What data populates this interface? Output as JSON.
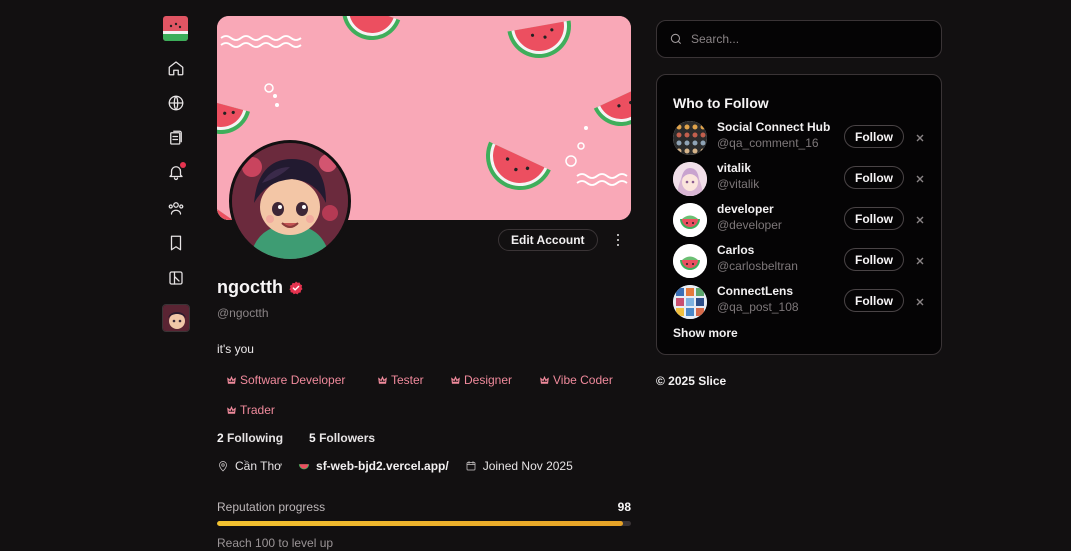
{
  "nav": {
    "icons": [
      "home-icon",
      "globe-icon",
      "clipboard-icon",
      "bell-icon",
      "users-icon",
      "bookmark-icon",
      "premium-icon"
    ],
    "notification_dot_color": "#e5334f"
  },
  "profile": {
    "display_name": "ngoctth",
    "handle": "@ngoctth",
    "bio": "it's you",
    "edit_label": "Edit Account",
    "tags": [
      "Software Developer",
      "Tester",
      "Designer",
      "Vibe Coder",
      "Trader"
    ],
    "following_count": "2",
    "following_label": "Following",
    "followers_count": "5",
    "followers_label": "Followers",
    "location": "Cần Thơ",
    "website": "sf-web-bjd2.vercel.app/",
    "joined": "Joined Nov 2025",
    "reputation_label": "Reputation progress",
    "reputation_value": "98",
    "reputation_progress": 0.98,
    "reputation_hint": "Reach 100 to level up"
  },
  "search": {
    "placeholder": "Search..."
  },
  "who_to_follow": {
    "title": "Who to Follow",
    "follow_label": "Follow",
    "show_more": "Show more",
    "users": [
      {
        "name": "Social Connect Hub",
        "handle": "@qa_comment_16",
        "avatar": "grid-avatar"
      },
      {
        "name": "vitalik",
        "handle": "@vitalik",
        "avatar": "anime-avatar"
      },
      {
        "name": "developer",
        "handle": "@developer",
        "avatar": "watermelon-avatar"
      },
      {
        "name": "Carlos",
        "handle": "@carlosbeltran",
        "avatar": "watermelon-avatar"
      },
      {
        "name": "ConnectLens",
        "handle": "@qa_post_108",
        "avatar": "mosaic-avatar"
      }
    ]
  },
  "footer": {
    "copyright": "© 2025 Slice"
  },
  "colors": {
    "accent_pink": "#f08a9c",
    "banner_pink": "#f9a8b7",
    "progress": "#f2c230",
    "verified": "#e5334f"
  }
}
